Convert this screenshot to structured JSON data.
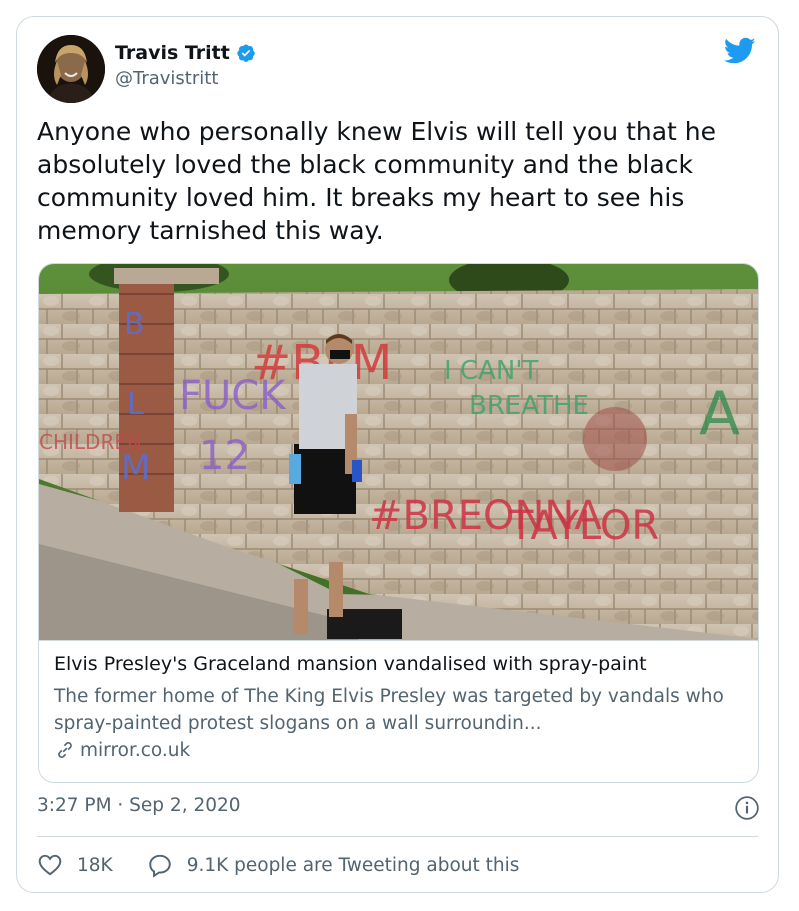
{
  "author": {
    "name": "Travis Tritt",
    "handle": "@Travistritt",
    "verified": true
  },
  "tweet": {
    "text": "Anyone who personally knew Elvis will tell you that he absolutely loved the black community and the black community loved him. It breaks my heart to see his memory tarnished this way."
  },
  "link_card": {
    "title": "Elvis Presley's Graceland mansion vandalised with spray-paint",
    "description": "The former home of The King Elvis Presley was targeted by vandals who spray-painted protest slogans on a wall surroundin...",
    "domain": "mirror.co.uk"
  },
  "meta": {
    "timestamp": "3:27 PM · Sep 2, 2020"
  },
  "actions": {
    "likes": "18K",
    "tweeting": "9.1K people are Tweeting about this"
  },
  "colors": {
    "brand_blue": "#1d9bf0",
    "text": "#0f1419",
    "secondary": "#536471",
    "border": "#cfd9de"
  }
}
